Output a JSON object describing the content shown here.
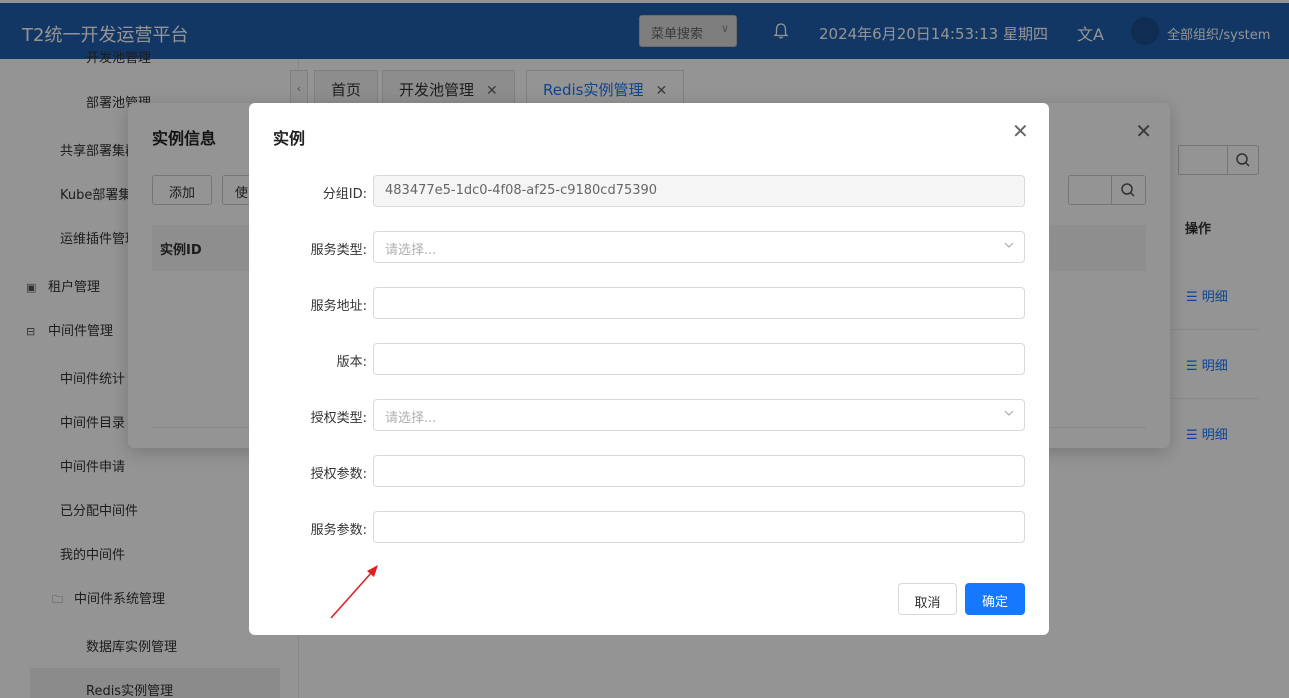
{
  "header": {
    "title": "T2统一开发运营平台",
    "menu_search": "菜单搜索",
    "datetime": "2024年6月20日14:53:13 星期四",
    "lang_icon": "文A",
    "org": "全部组织/system"
  },
  "sidebar": {
    "items": [
      {
        "label": "开发池管理"
      },
      {
        "label": "部署池管理"
      },
      {
        "label": "共享部署集群"
      },
      {
        "label": "Kube部署集群"
      },
      {
        "label": "运维插件管理"
      },
      {
        "label": "租户管理"
      },
      {
        "label": "中间件管理"
      },
      {
        "label": "中间件统计"
      },
      {
        "label": "中间件目录"
      },
      {
        "label": "中间件申请"
      },
      {
        "label": "已分配中间件"
      },
      {
        "label": "我的中间件"
      },
      {
        "label": "中间件系统管理"
      },
      {
        "label": "数据库实例管理"
      },
      {
        "label": "Redis实例管理"
      }
    ]
  },
  "tabs": [
    {
      "label": "首页"
    },
    {
      "label": "开发池管理"
    },
    {
      "label": "Redis实例管理"
    }
  ],
  "tab_close": "✕",
  "main": {
    "op_header": "操作",
    "detail_links": [
      "明细",
      "明细",
      "明细"
    ]
  },
  "dialog_info": {
    "title": "实例信息",
    "add_label": "添加",
    "use_label": "使",
    "col_instance_id": "实例ID",
    "close": "✕"
  },
  "dialog": {
    "title": "实例",
    "close": "✕",
    "fields": [
      {
        "label": "分组ID:",
        "value": "483477e5-1dc0-4f08-af25-c9180cd75390",
        "placeholder": ""
      },
      {
        "label": "服务类型:",
        "value": "",
        "placeholder": "请选择..."
      },
      {
        "label": "服务地址:",
        "value": "",
        "placeholder": ""
      },
      {
        "label": "版本:",
        "value": "",
        "placeholder": ""
      },
      {
        "label": "授权类型:",
        "value": "",
        "placeholder": "请选择..."
      },
      {
        "label": "授权参数:",
        "value": "",
        "placeholder": ""
      },
      {
        "label": "服务参数:",
        "value": "",
        "placeholder": ""
      }
    ],
    "cancel_label": "取消",
    "ok_label": "确定"
  },
  "colors": {
    "header_bg": "#1f5fae",
    "primary": "#1677ff",
    "annotation_arrow": "#e02020"
  }
}
